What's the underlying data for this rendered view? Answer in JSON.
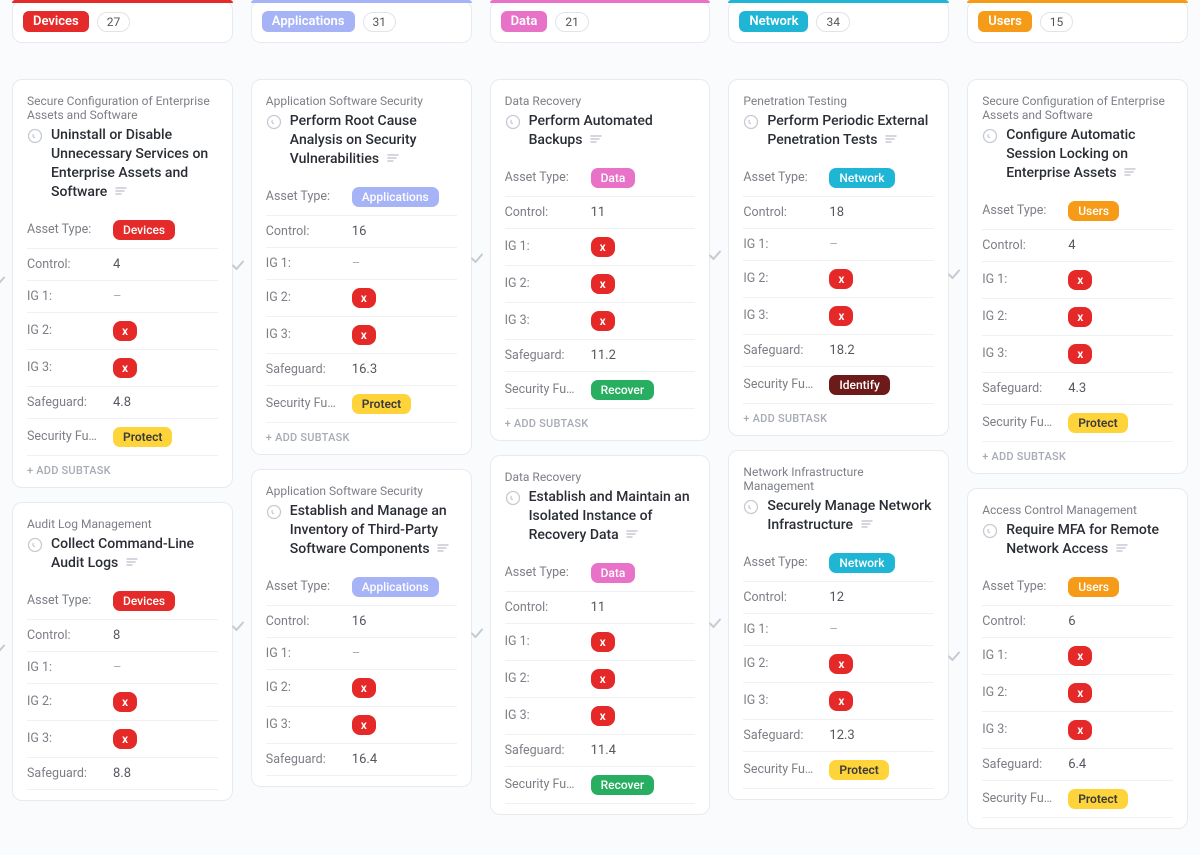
{
  "colors": {
    "Devices": {
      "stripe": "#e52a2a",
      "pill": "pill-red"
    },
    "Applications": {
      "stripe": "#a7b3f7",
      "pill": "pill-lav"
    },
    "Data": {
      "stripe": "#e872c8",
      "pill": "pill-pink"
    },
    "Network": {
      "stripe": "#1fb6d6",
      "pill": "pill-cyan"
    },
    "Users": {
      "stripe": "#f59b18",
      "pill": "pill-orange"
    }
  },
  "labels": {
    "asset_type": "Asset Type:",
    "control": "Control:",
    "ig1": "IG 1:",
    "ig2": "IG 2:",
    "ig3": "IG 3:",
    "safeguard": "Safeguard:",
    "secfn": "Security Fu…",
    "add_subtask": "+ ADD SUBTASK"
  },
  "secfn_pills": {
    "Protect": "pill-yellow",
    "Recover": "pill-green",
    "Identify": "pill-darkred"
  },
  "columns": [
    {
      "name": "Devices",
      "count": 27,
      "cards": [
        {
          "cat": "Secure Configuration of Enterprise Assets and Software",
          "title": "Uninstall or Disable Unnecessary Services on Enterprise Assets and Software",
          "asset": "Devices",
          "control": "4",
          "ig1": "–",
          "ig2": "x",
          "ig3": "x",
          "safeguard": "4.8",
          "secfn": "Protect",
          "add": true
        },
        {
          "cat": "Audit Log Management",
          "title": "Collect Command-Line Audit Logs",
          "asset": "Devices",
          "control": "8",
          "ig1": "–",
          "ig2": "x",
          "ig3": "x",
          "safeguard": "8.8"
        }
      ]
    },
    {
      "name": "Applications",
      "count": 31,
      "cards": [
        {
          "cat": "Application Software Security",
          "title": "Perform Root Cause Analysis on Security Vulnerabilities",
          "asset": "Applications",
          "control": "16",
          "ig1": "–",
          "ig2": "x",
          "ig3": "x",
          "safeguard": "16.3",
          "secfn": "Protect",
          "add": true
        },
        {
          "cat": "Application Software Security",
          "title": "Establish and Manage an Inventory of Third-Party Software Components",
          "asset": "Applications",
          "control": "16",
          "ig1": "–",
          "ig2": "x",
          "ig3": "x",
          "safeguard": "16.4"
        }
      ]
    },
    {
      "name": "Data",
      "count": 21,
      "cards": [
        {
          "cat": "Data Recovery",
          "title": "Perform Automated Backups",
          "asset": "Data",
          "control": "11",
          "ig1": "x",
          "ig2": "x",
          "ig3": "x",
          "safeguard": "11.2",
          "secfn": "Recover",
          "add": true
        },
        {
          "cat": "Data Recovery",
          "title": "Establish and Maintain an Isolated Instance of Recovery Data",
          "asset": "Data",
          "control": "11",
          "ig1": "x",
          "ig2": "x",
          "ig3": "x",
          "safeguard": "11.4",
          "secfn": "Recover"
        }
      ]
    },
    {
      "name": "Network",
      "count": 34,
      "cards": [
        {
          "cat": "Penetration Testing",
          "title": "Perform Periodic External Penetration Tests",
          "asset": "Network",
          "control": "18",
          "ig1": "–",
          "ig2": "x",
          "ig3": "x",
          "safeguard": "18.2",
          "secfn": "Identify",
          "add": true
        },
        {
          "cat": "Network Infrastructure Management",
          "title": "Securely Manage Network Infrastructure",
          "asset": "Network",
          "control": "12",
          "ig1": "–",
          "ig2": "x",
          "ig3": "x",
          "safeguard": "12.3",
          "secfn": "Protect"
        }
      ]
    },
    {
      "name": "Users",
      "count": 15,
      "cards": [
        {
          "cat": "Secure Configuration of Enterprise Assets and Software",
          "title": "Configure Automatic Session Locking on Enterprise Assets",
          "asset": "Users",
          "control": "4",
          "ig1": "x",
          "ig2": "x",
          "ig3": "x",
          "safeguard": "4.3",
          "secfn": "Protect",
          "add": true
        },
        {
          "cat": "Access Control Management",
          "title": "Require MFA for Remote Network Access",
          "asset": "Users",
          "control": "6",
          "ig1": "x",
          "ig2": "x",
          "ig3": "x",
          "safeguard": "6.4",
          "secfn": "Protect"
        }
      ]
    }
  ]
}
